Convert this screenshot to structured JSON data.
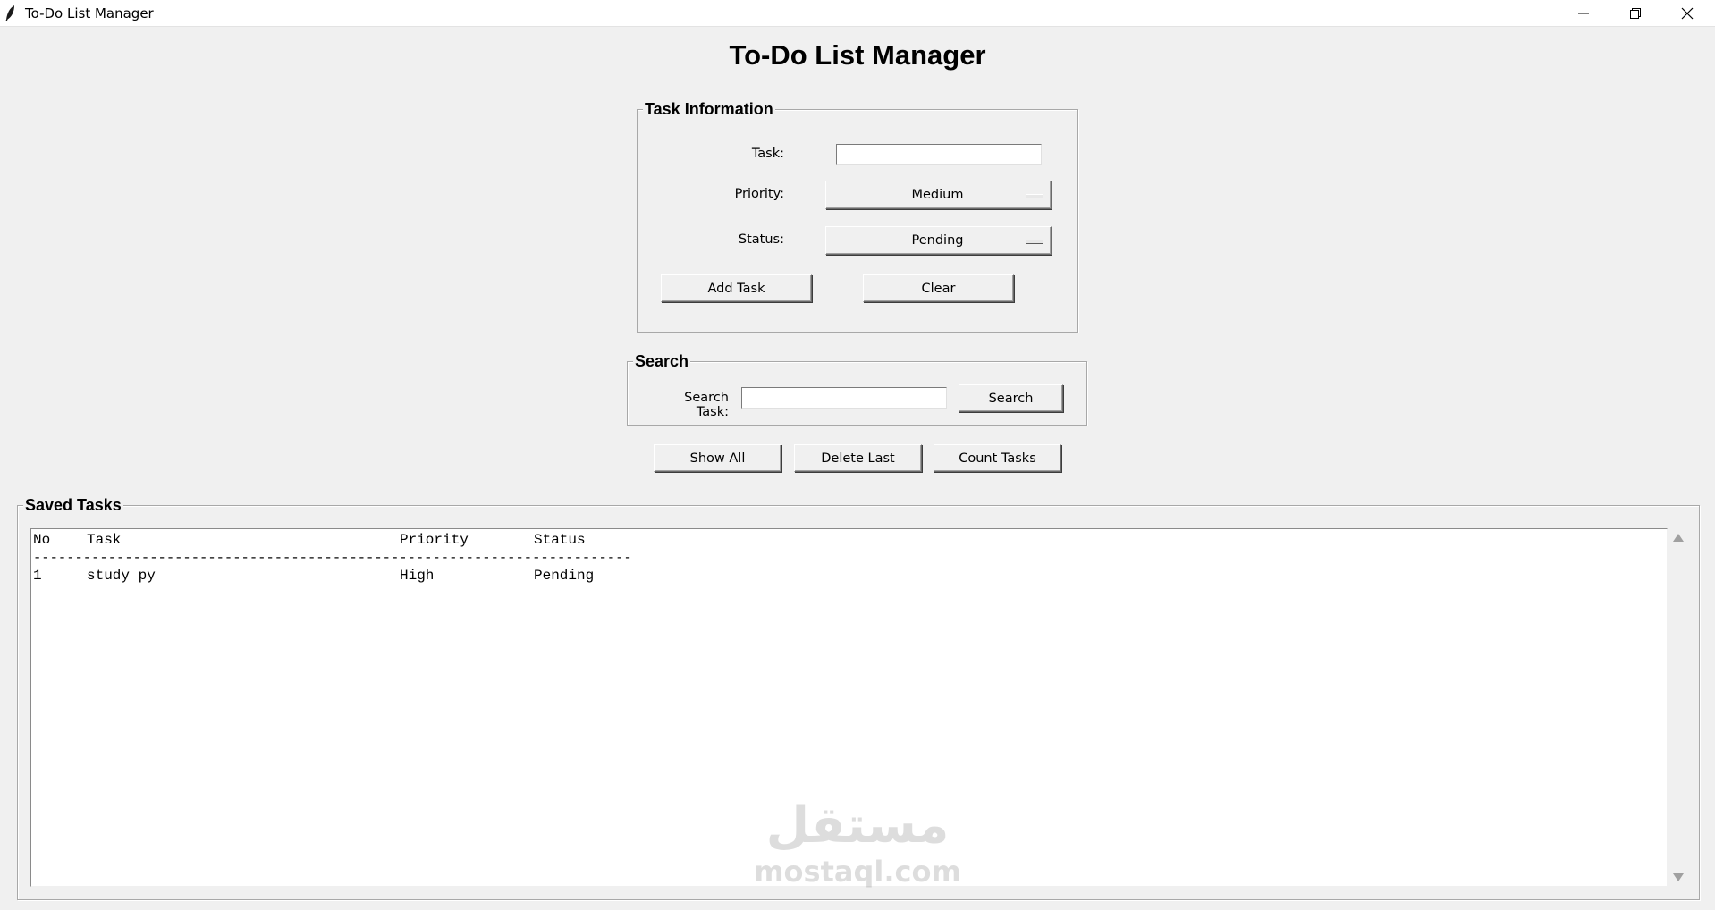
{
  "window": {
    "title": "To-Do List Manager",
    "controls": [
      "minimize-icon",
      "restore-icon",
      "close-icon"
    ]
  },
  "heading": "To-Do List Manager",
  "task_info": {
    "title": "Task Information",
    "task_label": "Task:",
    "task_value": "",
    "priority_label": "Priority:",
    "priority_value": "Medium",
    "status_label": "Status:",
    "status_value": "Pending",
    "add_label": "Add Task",
    "clear_label": "Clear"
  },
  "search": {
    "title": "Search",
    "label": "Search Task:",
    "value": "",
    "button_label": "Search"
  },
  "actions": {
    "show_all": "Show All",
    "delete_last": "Delete Last",
    "count_tasks": "Count Tasks"
  },
  "saved": {
    "title": "Saved Tasks",
    "header": {
      "no": "No",
      "task": "Task",
      "priority": "Priority",
      "status": "Status"
    },
    "separator": "------------------------------------------------------------------------",
    "rows": [
      {
        "no": "1",
        "task": "study py",
        "priority": "High",
        "status": "Pending"
      }
    ]
  },
  "watermark": {
    "arabic": "مستقل",
    "latin": "mostaql.com"
  }
}
